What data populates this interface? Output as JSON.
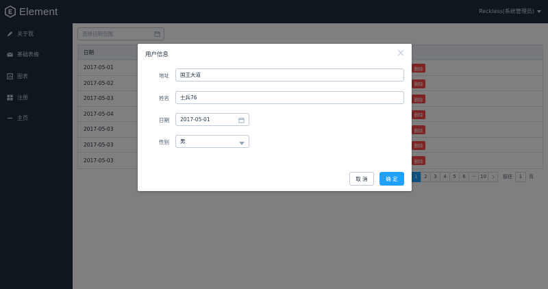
{
  "app": {
    "logo_text": "Element",
    "user": "Reckless(系统管理员)"
  },
  "sidebar": {
    "items": [
      {
        "label": "关于我",
        "icon": "pencil-icon"
      },
      {
        "label": "基础表格",
        "icon": "envelope-icon"
      },
      {
        "label": "图表",
        "icon": "chart-icon"
      },
      {
        "label": "注册",
        "icon": "grid-icon"
      },
      {
        "label": "主页",
        "icon": "minus-icon"
      }
    ]
  },
  "filter": {
    "date_range_placeholder": "选择日期范围"
  },
  "table": {
    "header_date": "日期",
    "rows": [
      "2017-05-01",
      "2017-05-02",
      "2017-05-03",
      "2017-05-04",
      "2017-05-03",
      "2017-05-03",
      "2017-05-03"
    ],
    "delete_label": "删除"
  },
  "pagination": {
    "pages": [
      "1",
      "2",
      "3",
      "4",
      "5",
      "6",
      "···",
      "10"
    ],
    "current": "1",
    "goto_label": "前往",
    "goto_value": "1",
    "page_unit": "页"
  },
  "dialog": {
    "title": "用户信息",
    "address_label": "地址",
    "address_value": "国王大道",
    "name_label": "姓名",
    "name_value": "士兵76",
    "date_label": "日期",
    "date_value": "2017-05-01",
    "gender_label": "性别",
    "gender_value": "男",
    "cancel_label": "取 消",
    "confirm_label": "确 定"
  },
  "colors": {
    "primary": "#20a0ff",
    "danger": "#ff4949",
    "header_bg": "#1f2d3d"
  }
}
